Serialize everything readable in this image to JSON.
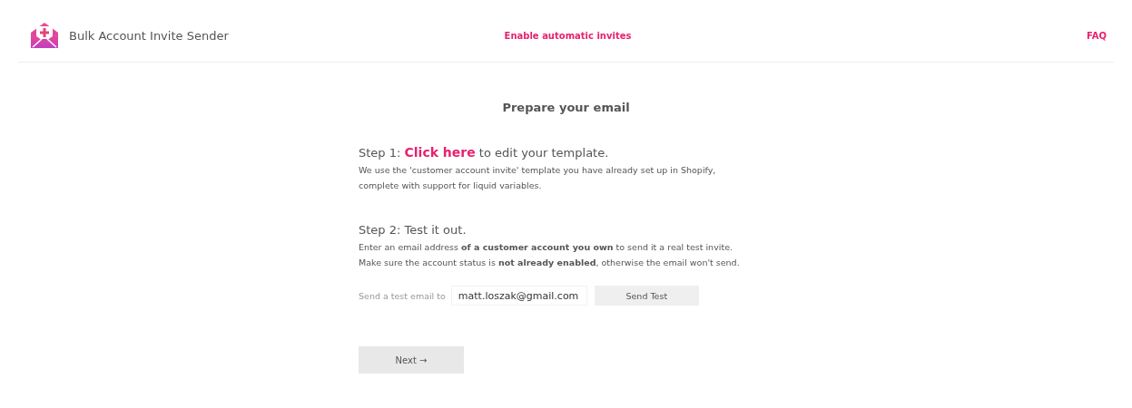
{
  "header": {
    "app_name": "Bulk Account Invite Sender",
    "center_link": "Enable automatic invites",
    "right_link": "FAQ"
  },
  "title": "Prepare your email",
  "step1": {
    "prefix": "Step 1: ",
    "link": "Click here",
    "suffix": " to edit your template.",
    "description": "We use the 'customer account invite' template you have already set up in Shopify, complete with support for liquid variables."
  },
  "step2": {
    "heading": "Step 2: Test it out.",
    "lines": [
      "Enter an email address **of a customer account you own** to send it a real test invite.",
      "Make sure the account status is **not already enabled**, otherwise the email won't send."
    ]
  },
  "test_form": {
    "label": "Send a test email to",
    "value": "matt.loszak@gmail.com",
    "button": "Send Test"
  },
  "next_button": "Next →"
}
